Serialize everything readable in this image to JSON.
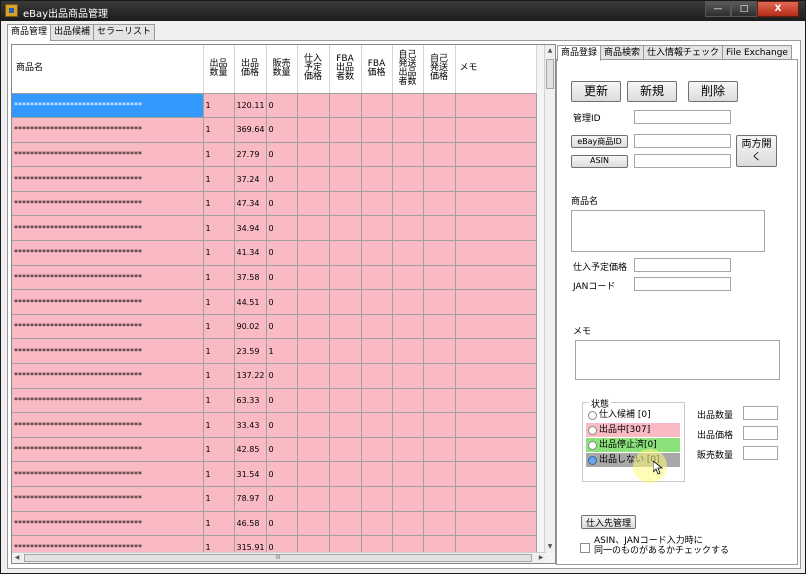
{
  "window": {
    "title": "eBay出品商品管理",
    "minimize": "—",
    "maximize": "□",
    "close": "X"
  },
  "main_tabs": [
    "商品管理",
    "出品候補",
    "セラーリスト"
  ],
  "grid": {
    "columns": [
      "商品名",
      "出品\n数量",
      "出品\n価格",
      "販売\n数量",
      "仕入\n予定\n価格",
      "FBA\n出品\n者数",
      "FBA\n価格",
      "自己\n発送\n出品\n者数",
      "自己\n発送\n価格",
      "メモ"
    ],
    "rows": [
      [
        "********************************",
        "1",
        "120.11",
        "0"
      ],
      [
        "********************************",
        "1",
        "369.64",
        "0"
      ],
      [
        "********************************",
        "1",
        "27.79",
        "0"
      ],
      [
        "********************************",
        "1",
        "37.24",
        "0"
      ],
      [
        "********************************",
        "1",
        "47.34",
        "0"
      ],
      [
        "********************************",
        "1",
        "34.94",
        "0"
      ],
      [
        "********************************",
        "1",
        "41.34",
        "0"
      ],
      [
        "********************************",
        "1",
        "37.58",
        "0"
      ],
      [
        "********************************",
        "1",
        "44.51",
        "0"
      ],
      [
        "********************************",
        "1",
        "90.02",
        "0"
      ],
      [
        "********************************",
        "1",
        "23.59",
        "1"
      ],
      [
        "********************************",
        "1",
        "137.22",
        "0"
      ],
      [
        "********************************",
        "1",
        "63.33",
        "0"
      ],
      [
        "********************************",
        "1",
        "33.43",
        "0"
      ],
      [
        "********************************",
        "1",
        "42.85",
        "0"
      ],
      [
        "********************************",
        "1",
        "31.54",
        "0"
      ],
      [
        "********************************",
        "1",
        "78.97",
        "0"
      ],
      [
        "********************************",
        "1",
        "46.58",
        "0"
      ],
      [
        "********************************",
        "1",
        "315.91",
        "0"
      ]
    ],
    "hscroll_grip": "III"
  },
  "right_tabs": [
    "商品登録",
    "商品検索",
    "仕入情報チェック",
    "File Exchange"
  ],
  "form": {
    "update_button": "更新",
    "new_button": "新規",
    "delete_button": "削除",
    "manage_id_label": "管理ID",
    "ebay_id_button": "eBay商品ID",
    "asin_button": "ASIN",
    "both_open_button": "両方開く",
    "product_name_label": "商品名",
    "purchase_price_label": "仕入予定価格",
    "jan_label": "JANコード",
    "memo_label": "メモ",
    "status_group": "状態",
    "status_options": [
      {
        "label": "仕入候補 [0]",
        "color": "#ffffff"
      },
      {
        "label": "出品中[307]",
        "color": "#f9bac4"
      },
      {
        "label": "出品停止済[0]",
        "color": "#8be27a"
      },
      {
        "label": "出品しない [0]",
        "color": "#a8a8a8"
      }
    ],
    "qty_label": "出品数量",
    "price_label": "出品価格",
    "sold_label": "販売数量",
    "supplier_button": "仕入先管理",
    "check_label_1": "ASIN、JANコード入力時に",
    "check_label_2": "同一のものがあるかチェックする"
  },
  "colors": {
    "row_pink": "#f9bac4",
    "selection_blue": "#3399ff"
  }
}
